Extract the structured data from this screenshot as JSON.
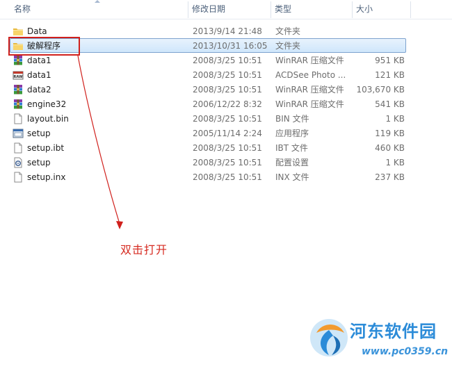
{
  "columns": {
    "name": "名称",
    "date": "修改日期",
    "type": "类型",
    "size": "大小"
  },
  "files": [
    {
      "name": "Data",
      "date": "2013/9/14 21:48",
      "type": "文件夹",
      "size": "",
      "icon": "folder-icon",
      "selected": false
    },
    {
      "name": "破解程序",
      "date": "2013/10/31 16:05",
      "type": "文件夹",
      "size": "",
      "icon": "folder-icon",
      "selected": true
    },
    {
      "name": "data1",
      "date": "2008/3/25 10:51",
      "type": "WinRAR 压缩文件",
      "size": "951 KB",
      "icon": "winrar-icon",
      "selected": false
    },
    {
      "name": "data1",
      "date": "2008/3/25 10:51",
      "type": "ACDSee Photo ...",
      "size": "121 KB",
      "icon": "acdsee-raw-icon",
      "selected": false
    },
    {
      "name": "data2",
      "date": "2008/3/25 10:51",
      "type": "WinRAR 压缩文件",
      "size": "103,670 KB",
      "icon": "winrar-icon",
      "selected": false
    },
    {
      "name": "engine32",
      "date": "2006/12/22 8:32",
      "type": "WinRAR 压缩文件",
      "size": "541 KB",
      "icon": "winrar-icon",
      "selected": false
    },
    {
      "name": "layout.bin",
      "date": "2008/3/25 10:51",
      "type": "BIN 文件",
      "size": "1 KB",
      "icon": "file-icon",
      "selected": false
    },
    {
      "name": "setup",
      "date": "2005/11/14 2:24",
      "type": "应用程序",
      "size": "119 KB",
      "icon": "setup-exe-icon",
      "selected": false
    },
    {
      "name": "setup.ibt",
      "date": "2008/3/25 10:51",
      "type": "IBT 文件",
      "size": "460 KB",
      "icon": "file-icon",
      "selected": false
    },
    {
      "name": "setup",
      "date": "2008/3/25 10:51",
      "type": "配置设置",
      "size": "1 KB",
      "icon": "config-gear-icon",
      "selected": false
    },
    {
      "name": "setup.inx",
      "date": "2008/3/25 10:51",
      "type": "INX 文件",
      "size": "237 KB",
      "icon": "file-icon",
      "selected": false
    }
  ],
  "annotation": {
    "text": "双击打开",
    "color": "#d62a20"
  },
  "watermark": {
    "site_name": "河东软件园",
    "url": "www.pc0359.cn"
  },
  "colors": {
    "selection_fill": "#cfe6fb",
    "selection_border": "#7da2ce",
    "header_text": "#4c607a"
  }
}
